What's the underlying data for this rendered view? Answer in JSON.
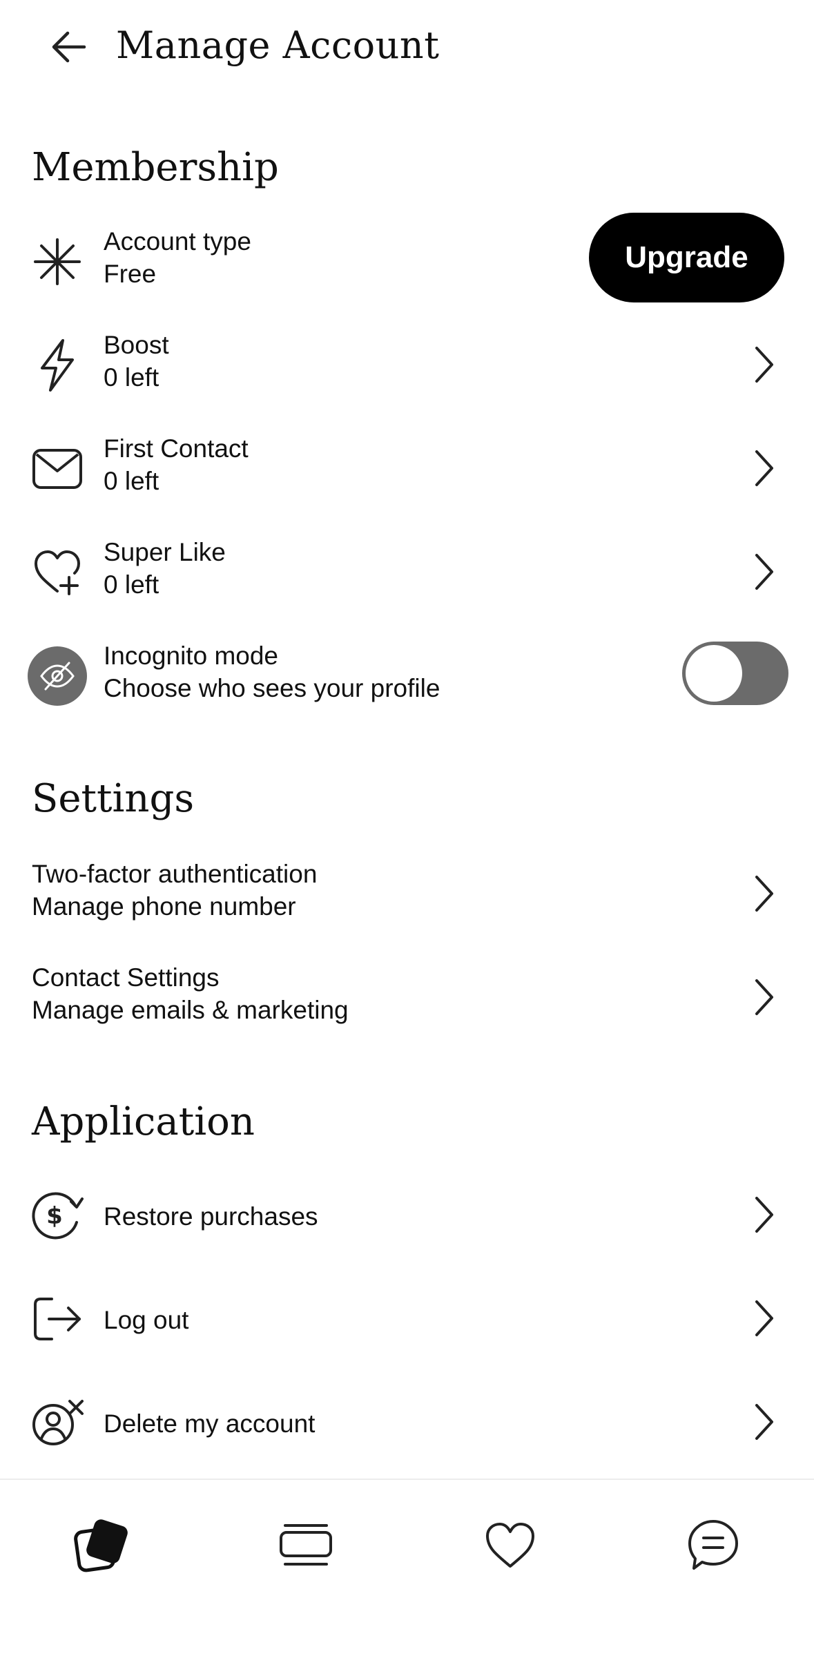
{
  "header": {
    "title": "Manage Account",
    "back_icon": "arrow-left-icon"
  },
  "membership": {
    "title": "Membership",
    "account_type": {
      "label": "Account type",
      "value": "Free",
      "icon": "asterisk-icon"
    },
    "upgrade_label": "Upgrade",
    "boost": {
      "label": "Boost",
      "value": "0 left",
      "icon": "lightning-icon"
    },
    "first_contact": {
      "label": "First Contact",
      "value": "0 left",
      "icon": "envelope-icon"
    },
    "super_like": {
      "label": "Super Like",
      "value": "0 left",
      "icon": "heart-plus-icon"
    },
    "incognito": {
      "label": "Incognito mode",
      "value": "Choose who sees your profile",
      "icon": "eye-slash-icon",
      "enabled": false
    }
  },
  "settings": {
    "title": "Settings",
    "two_factor": {
      "label": "Two-factor authentication",
      "value": "Manage phone number"
    },
    "contact": {
      "label": "Contact Settings",
      "value": "Manage emails & marketing"
    }
  },
  "application": {
    "title": "Application",
    "restore": {
      "label": "Restore purchases",
      "icon": "dollar-refresh-icon"
    },
    "logout": {
      "label": "Log out",
      "icon": "logout-icon"
    },
    "delete": {
      "label": "Delete my account",
      "icon": "user-remove-icon"
    }
  },
  "bottom_nav": {
    "tabs": [
      {
        "icon": "cards-icon",
        "active": true
      },
      {
        "icon": "stack-icon",
        "active": false
      },
      {
        "icon": "heart-icon",
        "active": false
      },
      {
        "icon": "chat-icon",
        "active": false
      }
    ]
  },
  "colors": {
    "accent": "#000000",
    "toggle_off": "#6b6b6b",
    "text": "#111111"
  }
}
